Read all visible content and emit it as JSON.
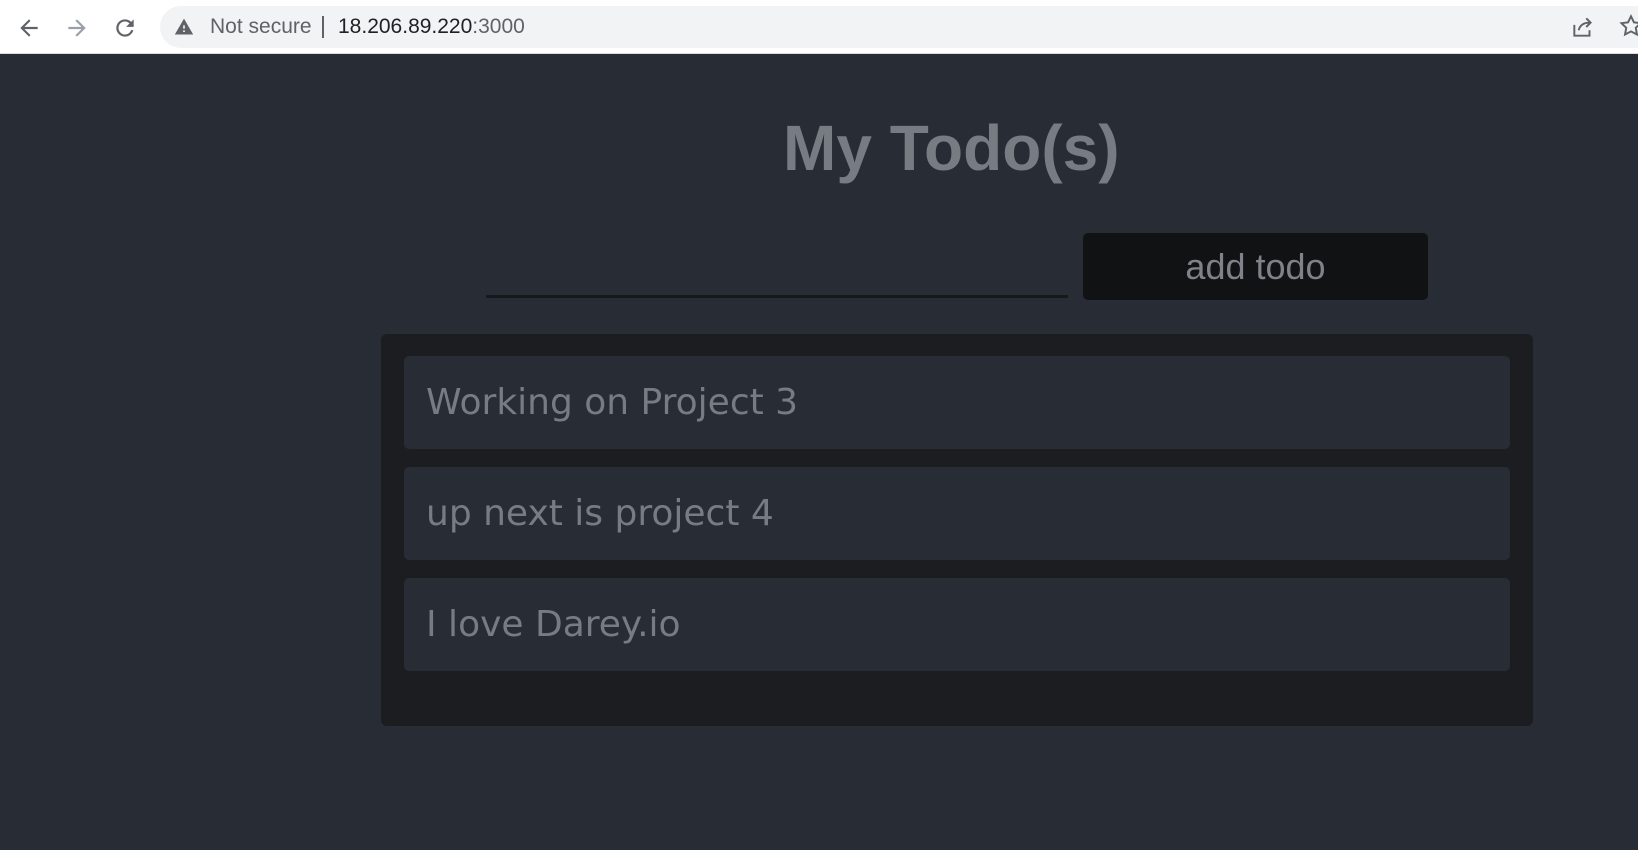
{
  "browser": {
    "security_label": "Not secure",
    "url_host": "18.206.89.220",
    "url_port": ":3000",
    "icons": [
      "back-arrow-icon",
      "forward-arrow-icon",
      "reload-icon",
      "warning-icon",
      "share-icon",
      "star-icon"
    ]
  },
  "app": {
    "title": "My Todo(s)",
    "input_value": "",
    "add_button_label": "add todo",
    "todos": [
      "Working on Project 3",
      "up next is project 4",
      "I love Darey.io"
    ]
  },
  "colors": {
    "page_background": "#282c34",
    "list_background": "#1b1d21",
    "button_background": "#111214",
    "text_muted": "#777b82"
  }
}
